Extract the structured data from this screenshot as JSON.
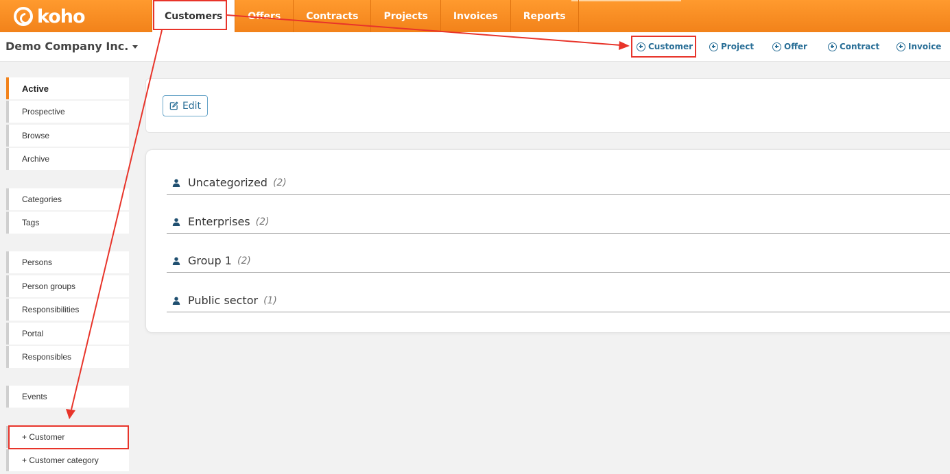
{
  "app": {
    "logo_text": "koho",
    "company": "Demo Company Inc."
  },
  "nav": {
    "tabs": [
      {
        "label": "Customers",
        "active": true
      },
      {
        "label": "Offers"
      },
      {
        "label": "Contracts"
      },
      {
        "label": "Projects"
      },
      {
        "label": "Invoices"
      },
      {
        "label": "Reports"
      }
    ]
  },
  "quick_actions": [
    {
      "label": "Customer"
    },
    {
      "label": "Project"
    },
    {
      "label": "Offer"
    },
    {
      "label": "Contract"
    },
    {
      "label": "Invoice"
    }
  ],
  "sidebar": {
    "items": [
      {
        "label": "Active",
        "active": true
      },
      {
        "label": "Prospective"
      },
      {
        "label": "Browse"
      },
      {
        "label": "Archive"
      },
      {
        "label": "Categories"
      },
      {
        "label": "Tags"
      },
      {
        "label": "Persons"
      },
      {
        "label": "Person groups"
      },
      {
        "label": "Responsibilities"
      },
      {
        "label": "Portal"
      },
      {
        "label": "Responsibles"
      },
      {
        "label": "Events"
      },
      {
        "label": "+ Customer"
      },
      {
        "label": "+ Customer category"
      }
    ]
  },
  "toolbar": {
    "edit_label": "Edit"
  },
  "groups": [
    {
      "name": "Uncategorized",
      "count": "(2)"
    },
    {
      "name": "Enterprises",
      "count": "(2)"
    },
    {
      "name": "Group 1",
      "count": "(2)"
    },
    {
      "name": "Public sector",
      "count": "(1)"
    }
  ],
  "colors": {
    "brand_orange": "#f2821a",
    "link_blue": "#2a6f97",
    "annotation_red": "#e8342a"
  }
}
